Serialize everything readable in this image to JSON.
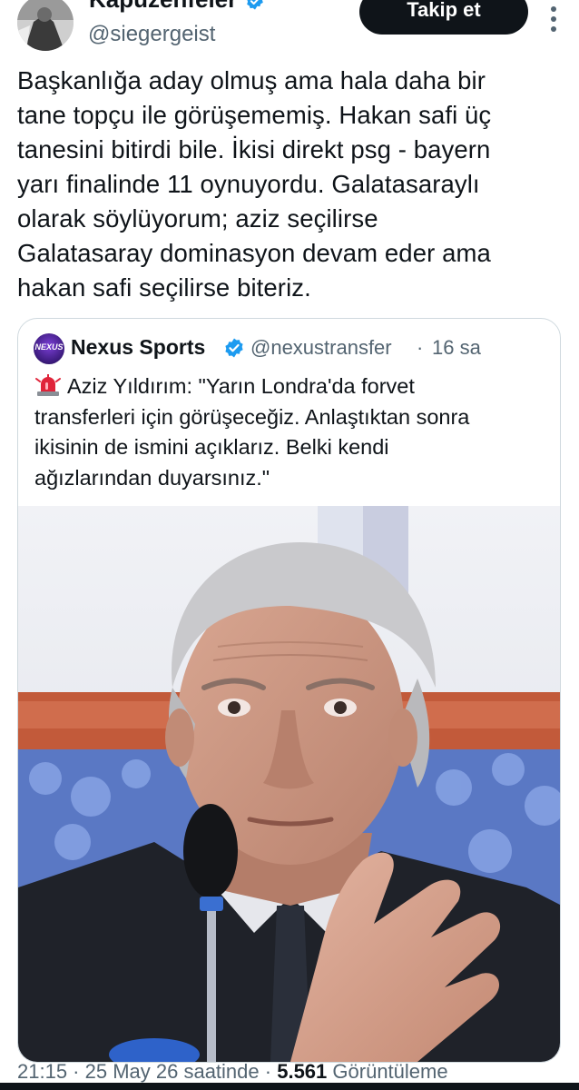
{
  "author": {
    "display_name": "Kapuzenfeier",
    "handle": "@siegergeist",
    "follow_label": "Takip et"
  },
  "tweet": {
    "lines": [
      "Başkanlığa aday olmuş ama hala daha bir",
      "tane topçu ile görüşememiş. Hakan safi üç",
      "tanesini bitirdi bile. İkisi direkt psg - bayern",
      "yarı finalinde 11 oynuyordu. Galatasaraylı",
      "olarak söylüyorum; aziz seçilirse",
      "Galatasaray dominasyon devam eder ama",
      "hakan safi seçilirse biteriz."
    ]
  },
  "quoted": {
    "avatar_text": "NEXUS",
    "name": "Nexus Sports",
    "handle": "@nexustransfer",
    "separator": "·",
    "time": "16 sa",
    "lines": [
      "Aziz Yıldırım: \"Yarın Londra'da forvet",
      "transferleri için görüşeceğiz. Anlaştıktan sonra",
      "ikisinin de ismini açıklarız. Belki kendi",
      "ağızlarından duyarsınız.\""
    ]
  },
  "meta": {
    "time": "21:15",
    "sep1": " · ",
    "date": "25 May 26 saatinde",
    "sep2": " · ",
    "views_count": "5.561",
    "views_label": "Görüntüleme"
  },
  "colors": {
    "text": "#0f1419",
    "secondary": "#536471",
    "verified": "#1d9bf0",
    "border": "#cfd9de",
    "siren": "#e0243a"
  },
  "icons": {
    "verified": "verified-badge-icon",
    "more": "more-dots-icon",
    "siren": "rotating-light-icon"
  }
}
